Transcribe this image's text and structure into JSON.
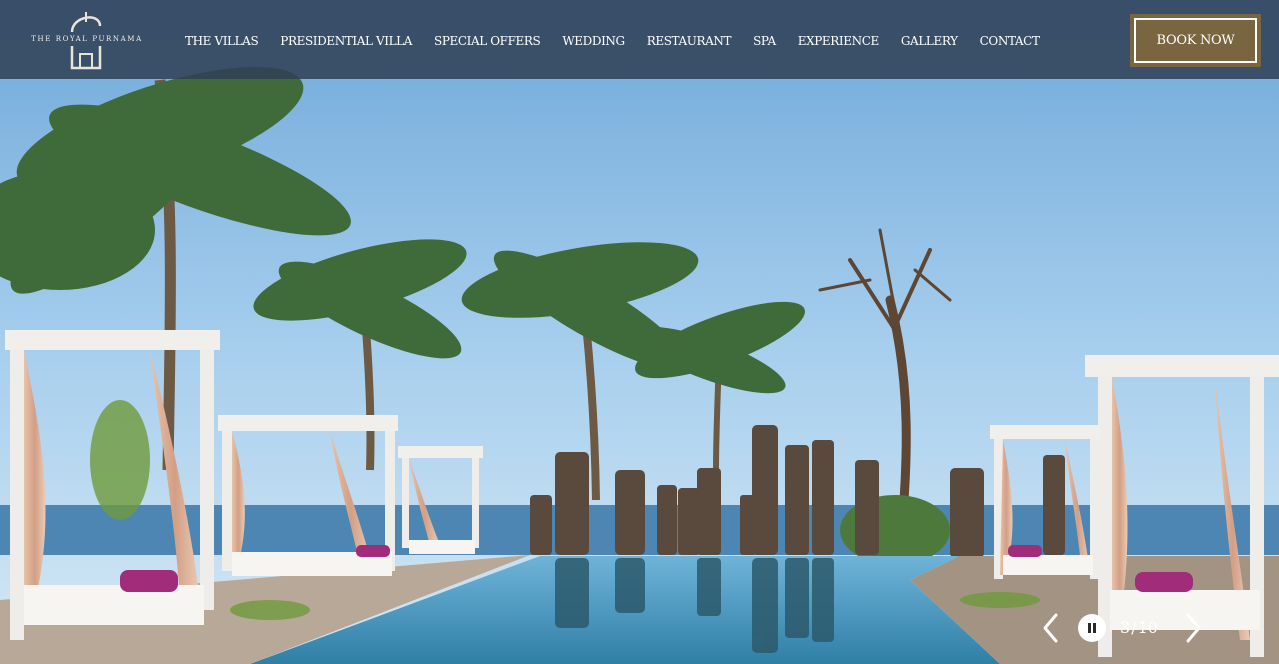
{
  "brand": {
    "logo_text": "THE ROYAL PURNAMA"
  },
  "nav": {
    "items": [
      {
        "label": "THE VILLAS"
      },
      {
        "label": "PRESIDENTIAL VILLA"
      },
      {
        "label": "SPECIAL OFFERS"
      },
      {
        "label": "WEDDING"
      },
      {
        "label": "RESTAURANT"
      },
      {
        "label": "SPA"
      },
      {
        "label": "EXPERIENCE"
      },
      {
        "label": "GALLERY"
      },
      {
        "label": "CONTACT"
      }
    ]
  },
  "book_button": {
    "label": "BOOK NOW"
  },
  "slider": {
    "current": "3",
    "separator": "/",
    "total": "10",
    "prev_icon": "chevron-left-icon",
    "next_icon": "chevron-right-icon",
    "pause_icon": "pause-icon"
  },
  "colors": {
    "nav_bar": "#304056",
    "book_button": "#79653f",
    "sky": "#8fc0e6",
    "pool": "#3f8fb4"
  }
}
